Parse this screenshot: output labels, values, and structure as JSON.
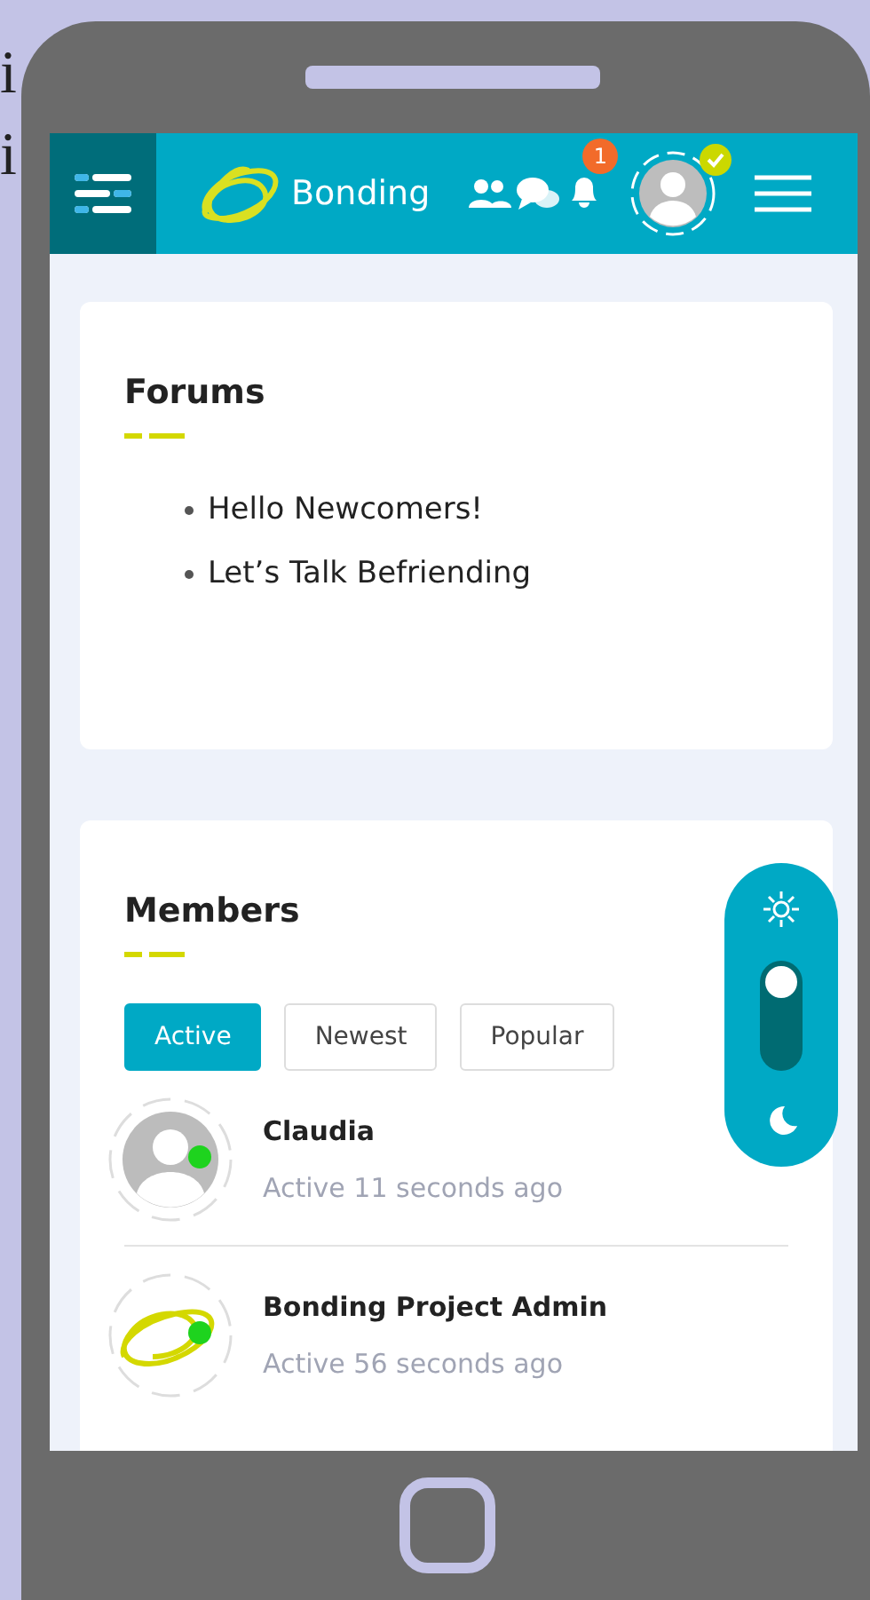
{
  "side_text": [
    "i",
    "i"
  ],
  "header": {
    "brand": "Bonding",
    "notification_count": "1",
    "avatar_verified": true
  },
  "forums": {
    "title": "Forums",
    "items": [
      "Hello Newcomers!",
      "Let’s Talk Befriending"
    ]
  },
  "members": {
    "title": "Members",
    "filters": [
      {
        "label": "Active",
        "selected": true
      },
      {
        "label": "Newest",
        "selected": false
      },
      {
        "label": "Popular",
        "selected": false
      }
    ],
    "list": [
      {
        "name": "Claudia",
        "status": "Active 11 seconds ago",
        "kind": "default",
        "online": true
      },
      {
        "name": "Bonding Project Admin",
        "status": "Active 56 seconds ago",
        "kind": "logo",
        "online": true
      }
    ]
  },
  "theme_toggle": {
    "dark_mode": false
  }
}
